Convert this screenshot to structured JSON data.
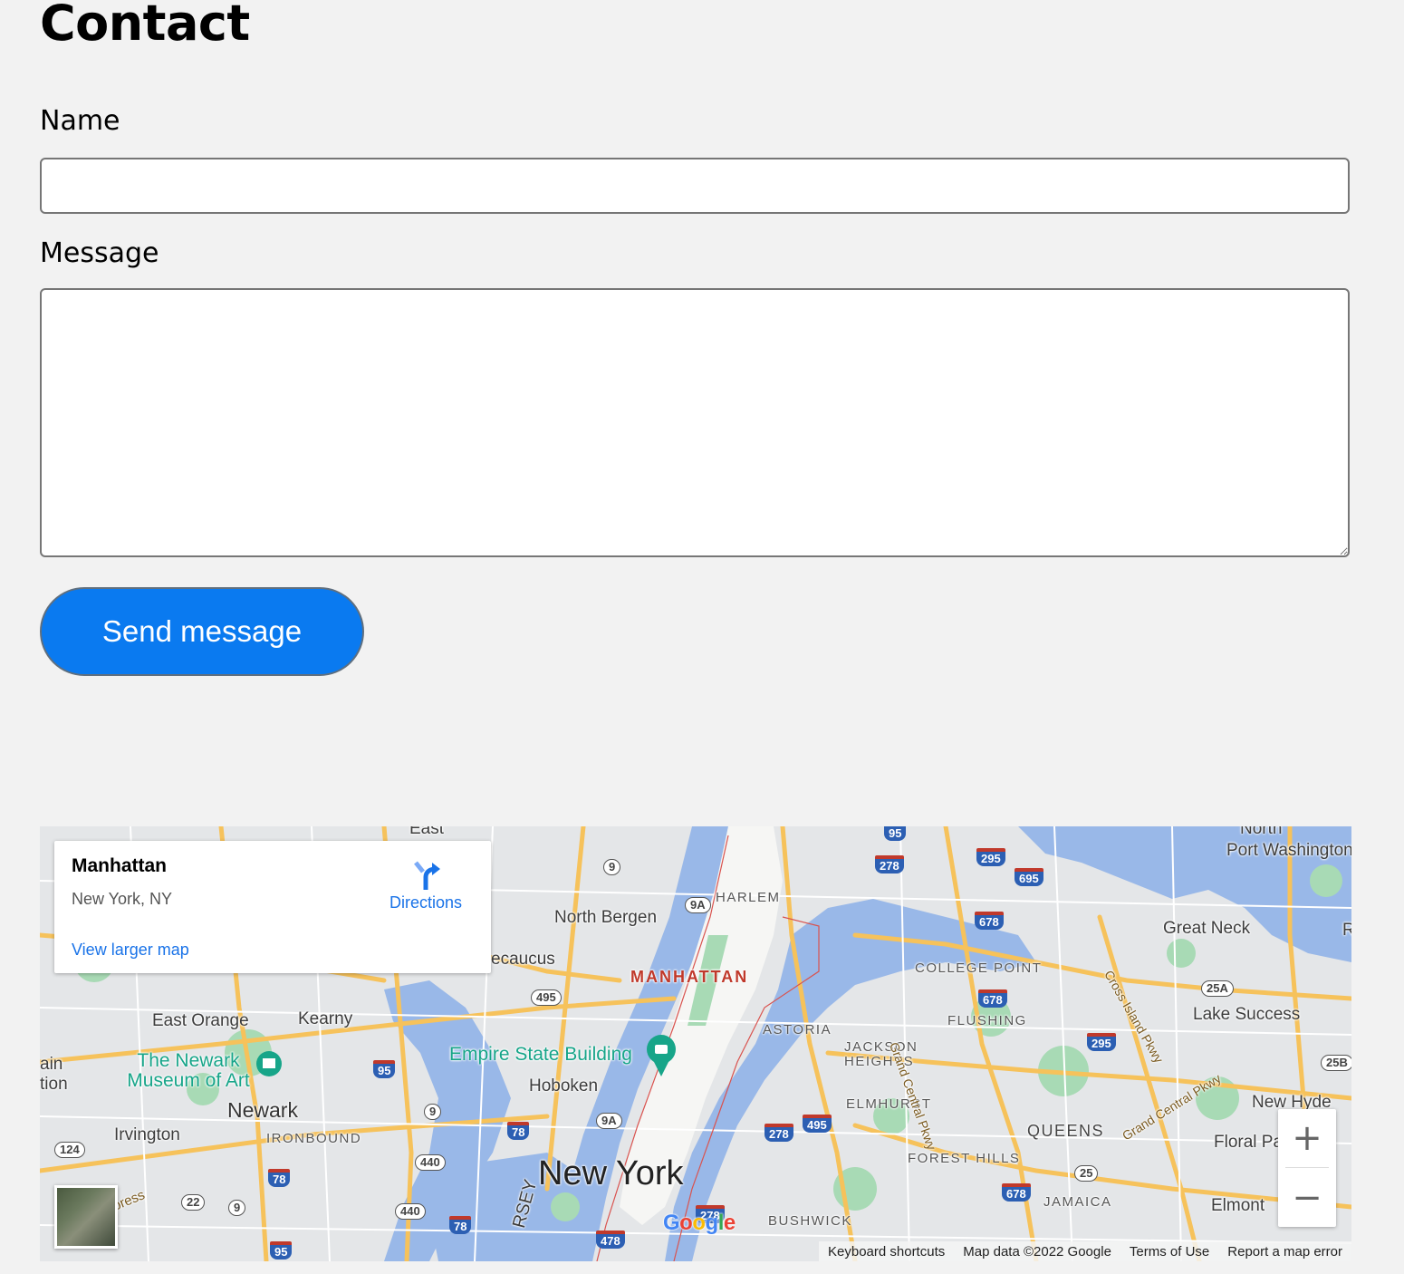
{
  "page": {
    "title": "Contact"
  },
  "form": {
    "name_label": "Name",
    "name_value": "",
    "message_label": "Message",
    "message_value": "",
    "submit_label": "Send message"
  },
  "map": {
    "info": {
      "place": "Manhattan",
      "address": "New York, NY",
      "directions_label": "Directions",
      "larger_map_label": "View larger map"
    },
    "labels": {
      "port_washington": "Port Washington",
      "north_bergen": "North Bergen",
      "harlem": "HARLEM",
      "great_neck": "Great Neck",
      "secaucus": "ecaucus",
      "manhattan": "MANHATTAN",
      "college_point": "COLLEGE POINT",
      "east_orange": "East Orange",
      "kearny": "Kearny",
      "astoria": "ASTORIA",
      "flushing": "FLUSHING",
      "lake_success": "Lake Success",
      "newark_museum": "The Newark Museum of Art",
      "empire_state": "Empire State Building",
      "jackson_heights": "JACKSON HEIGHTS",
      "hoboken": "Hoboken",
      "newark": "Newark",
      "elmhurst": "ELMHURST",
      "new_hyde": "New Hyde",
      "irvington": "Irvington",
      "ironbound": "IRONBOUND",
      "queens": "QUEENS",
      "floral_park": "Floral Pa",
      "new_york": "New York",
      "forest_hills": "FOREST HILLS",
      "jamaica": "JAMAICA",
      "elmont": "Elmont",
      "bushwick": "BUSHWICK",
      "grand_central": "Grand Central Pkwy",
      "cross_island": "Cross Island Pkwy",
      "east_rutherford": "East",
      "north": "North",
      "edge_r": "R",
      "edge_ain": "ain",
      "edge_tion": "tion",
      "jersey": "RSEY",
      "press": "press"
    },
    "shields": {
      "s95a": "95",
      "s9a": "9",
      "s278a": "278",
      "s295a": "295",
      "s695": "695",
      "s9A_1": "9A",
      "s678a": "678",
      "s495a": "495",
      "s25A": "25A",
      "s678b": "678",
      "s95b": "95",
      "s295b": "295",
      "s25B": "25B",
      "s9b": "9",
      "s78a": "78",
      "s9A_2": "9A",
      "s278b": "278",
      "s495b": "495",
      "s124": "124",
      "s440a": "440",
      "s78b": "78",
      "s25": "25",
      "s22": "22",
      "s9c": "9",
      "s440b": "440",
      "s78c": "78",
      "s278c": "278",
      "s678c": "678",
      "s95c": "95",
      "s478": "478"
    },
    "zoom_in": "+",
    "zoom_out": "−",
    "google_logo": [
      "G",
      "o",
      "o",
      "g",
      "l",
      "e"
    ],
    "google_colors": [
      "#4285f4",
      "#ea4335",
      "#fbbc05",
      "#4285f4",
      "#34a853",
      "#ea4335"
    ],
    "footer": {
      "shortcuts": "Keyboard shortcuts",
      "data": "Map data ©2022 Google",
      "terms": "Terms of Use",
      "report": "Report a map error"
    }
  },
  "colors": {
    "background": "#f2f2f2",
    "button": "#0a7af0",
    "water": "#99b8e8",
    "park": "#a8dab5",
    "road": "#f6c25b",
    "link": "#1a73e8"
  }
}
